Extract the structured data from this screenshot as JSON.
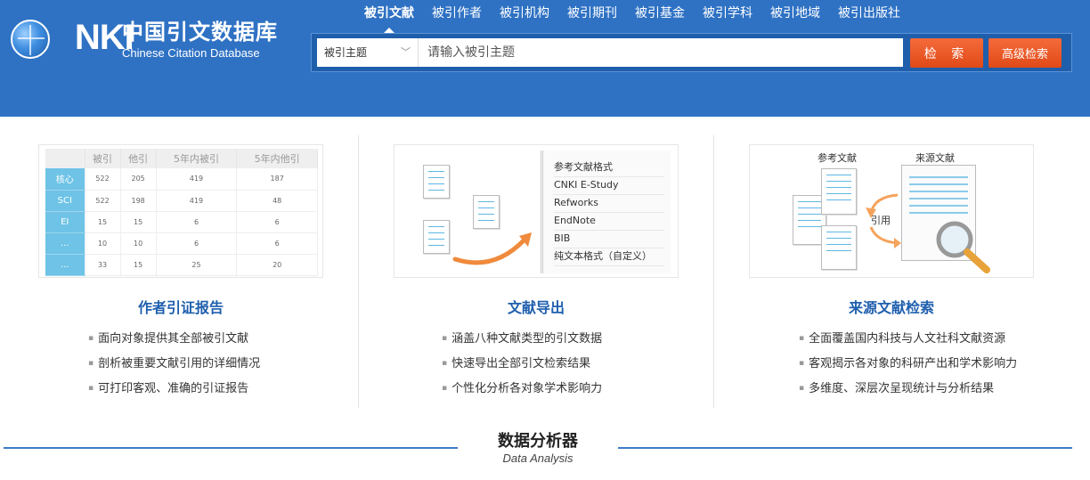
{
  "logo": {
    "en": "CNKI",
    "cn": "中国引文数据库",
    "sub": "Chinese Citation Database"
  },
  "nav": [
    {
      "label": "被引文献",
      "active": true
    },
    {
      "label": "被引作者"
    },
    {
      "label": "被引机构"
    },
    {
      "label": "被引期刊"
    },
    {
      "label": "被引基金"
    },
    {
      "label": "被引学科"
    },
    {
      "label": "被引地域"
    },
    {
      "label": "被引出版社"
    }
  ],
  "search": {
    "field": "被引主题",
    "placeholder": "请输入被引主题",
    "search_label": "检 索",
    "advanced_label": "高级检索"
  },
  "features": [
    {
      "title": "作者引证报告",
      "items": [
        "面向对象提供其全部被引文献",
        "剖析被重要文献引用的详细情况",
        "可打印客观、准确的引证报告"
      ],
      "table": {
        "headers": [
          "",
          "被引",
          "他引",
          "5年内被引",
          "5年内他引"
        ],
        "rows": [
          [
            "核心",
            "522",
            "205",
            "419",
            "187"
          ],
          [
            "SCI",
            "522",
            "198",
            "419",
            "48"
          ],
          [
            "EI",
            "15",
            "15",
            "6",
            "6"
          ],
          [
            "...",
            "10",
            "10",
            "6",
            "6"
          ],
          [
            "...",
            "33",
            "15",
            "25",
            "20"
          ]
        ]
      }
    },
    {
      "title": "文献导出",
      "items": [
        "涵盖八种文献类型的引文数据",
        "快速导出全部引文检索结果",
        "个性化分析各对象学术影响力"
      ],
      "formats": [
        "参考文献格式",
        "CNKI E-Study",
        "Refworks",
        "EndNote",
        "BIB",
        "纯文本格式（自定义）"
      ]
    },
    {
      "title": "来源文献检索",
      "items": [
        "全面覆盖国内科技与人文社科文献资源",
        "客观揭示各对象的科研产出和学术影响力",
        "多维度、深层次呈现统计与分析结果"
      ],
      "labels": {
        "ref": "参考文献",
        "source": "来源文献",
        "cite": "引用"
      }
    }
  ],
  "section": {
    "title": "数据分析器",
    "subtitle": "Data Analysis"
  },
  "colors": {
    "header": "#2f72c4",
    "accent": "#1f5fae",
    "button": "#e04a17"
  }
}
